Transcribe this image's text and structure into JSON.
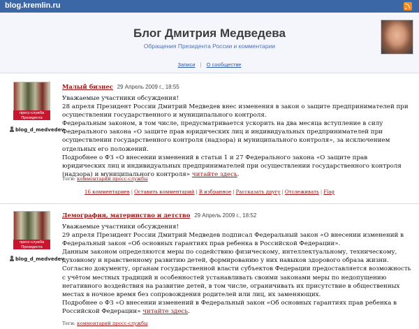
{
  "site": {
    "name": "blog.kremlin.ru",
    "rss_icon": "rss-icon"
  },
  "header": {
    "title": "Блог Дмитрия Медведева",
    "subtitle": "Обращения Президента России и комментарии"
  },
  "nav": {
    "entries": "Записи",
    "about": "О сообществе"
  },
  "posts": [
    {
      "avatar_label": "пресс-служба Президента",
      "username": "blog_d_medvedev",
      "title": "Малый бизнес",
      "date": "29 Апрель 2009 г., 18:55",
      "body": [
        "Уважаемые участники обсуждения!",
        "28 апреля Президент России Дмитрий Медведев внес изменения в закон о защите предпринимателей при осуществлении государственного и муниципального контроля.",
        "Федеральным законом, в том числе, предусматривается ускорить на два месяца вступление в силу Федерального закона «О защите прав юридических лиц и индивидуальных предпринимателей при осуществлении государственного контроля (надзора) и муниципального контроля», за исключением отдельных его положений."
      ],
      "more_text": "Подробнее о ФЗ «О внесении изменений в статьи 1 и 27 Федерального закона «О защите прав юридических лиц и индивидуальных предпринимателей при осуществлении государственного контроля (надзора) и муниципального контроля»",
      "read_link": "читайте здесь",
      "tags_label": "Теги:",
      "tag": "комментарий пресс-службы",
      "actions": [
        "16 комментариев",
        "Оставить комментарий",
        "В избранное",
        "Рассказать другу",
        "Отслеживать",
        "Flag"
      ]
    },
    {
      "avatar_label": "пресс-служба Президента",
      "username": "blog_d_medvedev",
      "title": "Демография, материнство и детство",
      "date": "29 Апрель 2009 г., 18:52",
      "body": [
        "Уважаемые участники обсуждения!",
        "29 апреля Президент России Дмитрий Медведев подписал Федеральный закон «О внесении изменений в Федеральный закон «Об основных гарантиях прав ребенка в Российской Федерации».",
        "Данным законом определяются меры по содействию физическому, интеллектуальному, техническому, духовному и нравственному развитию детей, формированию у них навыков здорового образа жизни.",
        "Согласно документу, органам государственной власти субъектов Федерации предоставляется возможность с учётом местных традиций и особенностей устанавливать своими законами меры по недопущению негативного воздействия на развитие детей, в том числе, ограничивать их присутствие в общественных местах в ночное время без сопровождения родителей или лиц, их заменяющих."
      ],
      "more_text": "Подробнее о ФЗ «О внесении изменений в Федеральный закон «Об основных гарантиях прав ребенка в Российской Федерации»",
      "read_link": "читайте здесь",
      "tags_label": "Теги:",
      "tag": "комментарий пресс-службы"
    }
  ]
}
